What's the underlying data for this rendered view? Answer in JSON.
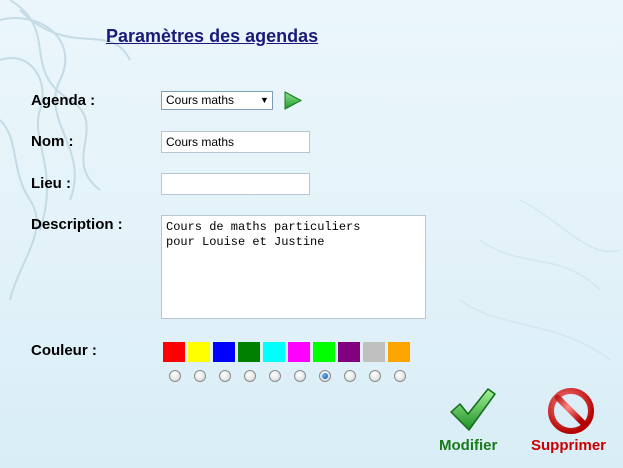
{
  "page": {
    "title": "Paramètres des agendas"
  },
  "form": {
    "agenda_label": "Agenda :",
    "agenda_selected": "Cours maths",
    "nom_label": "Nom :",
    "nom_value": "Cours maths",
    "lieu_label": "Lieu :",
    "lieu_value": "",
    "description_label": "Description :",
    "description_value": "Cours de maths particuliers\npour Louise et Justine",
    "couleur_label": "Couleur :"
  },
  "colors": {
    "swatches": [
      "#ff0000",
      "#ffff00",
      "#0000ff",
      "#008000",
      "#00ffff",
      "#ff00ff",
      "#00ff00",
      "#800080",
      "#c0c0c0",
      "#ffa500"
    ],
    "selected_index": 6
  },
  "actions": {
    "modify_label": "Modifier",
    "modify_color": "#1a7a1a",
    "delete_label": "Supprimer",
    "delete_color": "#cc0000"
  },
  "icons": {
    "go": "play-arrow-icon",
    "modify": "checkmark-icon",
    "delete": "forbidden-icon"
  }
}
